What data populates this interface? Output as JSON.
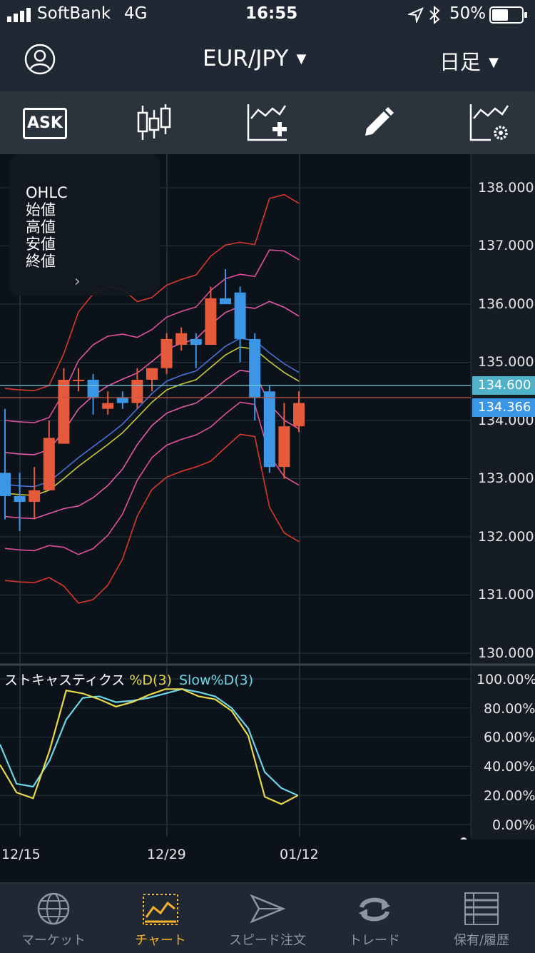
{
  "status_bar": {
    "carrier": "SoftBank",
    "network": "4G",
    "time": "16:55",
    "battery": "50%"
  },
  "header": {
    "pair": "EUR/JPY",
    "timeframe": "日足"
  },
  "toolbar": {
    "ask_label": "ASK"
  },
  "ohlc_panel": {
    "title": "OHLC",
    "open": "始値",
    "high": "高値",
    "low": "安値",
    "close": "終値"
  },
  "price_axis": [
    "138.000",
    "137.000",
    "136.000",
    "135.000",
    "134.000",
    "133.000",
    "132.000",
    "131.000",
    "130.000"
  ],
  "price_tags": {
    "ask": "134.600",
    "bid": "134.366"
  },
  "indicator": {
    "name": "ストキャスティクス",
    "d_label": "%D(3)",
    "slow_label": "Slow%D(3)"
  },
  "indicator_axis": [
    "100.00%",
    "80.00%",
    "60.00%",
    "40.00%",
    "20.00%",
    "0.00%"
  ],
  "dates": [
    "12/15",
    "12/29",
    "01/12"
  ],
  "tabs": [
    {
      "label": "マーケット"
    },
    {
      "label": "チャート"
    },
    {
      "label": "スピード注文"
    },
    {
      "label": "トレード"
    },
    {
      "label": "保有/履歴"
    }
  ],
  "colors": {
    "up": "#e65a3c",
    "down": "#3c96e6",
    "d_line": "#e6d84a",
    "slow_line": "#6ad6e6",
    "accent": "#f5b22c"
  },
  "chart_data": {
    "type": "candlestick",
    "ylim": [
      130,
      138.5
    ],
    "candles": [
      {
        "o": 133.1,
        "h": 134.2,
        "l": 132.3,
        "c": 132.7
      },
      {
        "o": 132.7,
        "h": 133.1,
        "l": 132.1,
        "c": 132.6
      },
      {
        "o": 132.6,
        "h": 133.2,
        "l": 132.3,
        "c": 132.8
      },
      {
        "o": 132.8,
        "h": 134.0,
        "l": 132.8,
        "c": 133.7
      },
      {
        "o": 133.6,
        "h": 134.9,
        "l": 133.6,
        "c": 134.7
      },
      {
        "o": 134.7,
        "h": 134.9,
        "l": 134.5,
        "c": 134.7
      },
      {
        "o": 134.7,
        "h": 134.8,
        "l": 134.1,
        "c": 134.4
      },
      {
        "o": 134.2,
        "h": 134.5,
        "l": 134.1,
        "c": 134.3
      },
      {
        "o": 134.4,
        "h": 134.5,
        "l": 134.2,
        "c": 134.3
      },
      {
        "o": 134.3,
        "h": 134.9,
        "l": 134.2,
        "c": 134.7
      },
      {
        "o": 134.7,
        "h": 134.9,
        "l": 134.5,
        "c": 134.9
      },
      {
        "o": 134.9,
        "h": 135.5,
        "l": 134.8,
        "c": 135.4
      },
      {
        "o": 135.3,
        "h": 135.6,
        "l": 135.2,
        "c": 135.5
      },
      {
        "o": 135.4,
        "h": 135.5,
        "l": 134.9,
        "c": 135.3
      },
      {
        "o": 135.3,
        "h": 136.3,
        "l": 135.3,
        "c": 136.1
      },
      {
        "o": 136.1,
        "h": 136.6,
        "l": 136.0,
        "c": 136.0
      },
      {
        "o": 136.2,
        "h": 136.3,
        "l": 135.0,
        "c": 135.4
      },
      {
        "o": 135.4,
        "h": 135.5,
        "l": 134.0,
        "c": 134.4
      },
      {
        "o": 134.5,
        "h": 134.6,
        "l": 133.1,
        "c": 133.2
      },
      {
        "o": 133.2,
        "h": 134.3,
        "l": 133.0,
        "c": 133.9
      },
      {
        "o": 133.9,
        "h": 134.5,
        "l": 133.8,
        "c": 134.3
      }
    ],
    "stoch_d": [
      41,
      22,
      18,
      51,
      92,
      90,
      86,
      81,
      84,
      89,
      93,
      93,
      88,
      86,
      78,
      61,
      19,
      14,
      20
    ],
    "stoch_slow": [
      55,
      28,
      26,
      44,
      72,
      87,
      88,
      84,
      85,
      87,
      90,
      93,
      91,
      88,
      80,
      66,
      36,
      25,
      20
    ]
  }
}
